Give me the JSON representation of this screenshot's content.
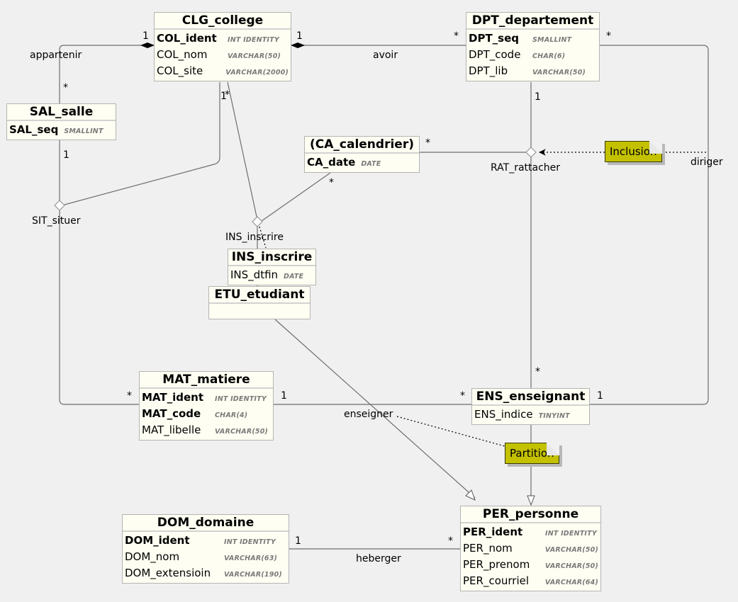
{
  "entities": {
    "clg": {
      "title": "CLG_college",
      "fields": [
        {
          "name": "COL_ident",
          "type": "INT IDENTITY",
          "pk": true
        },
        {
          "name": "COL_nom",
          "type": "VARCHAR(50)",
          "pk": false
        },
        {
          "name": "COL_site",
          "type": "VARCHAR(2000)",
          "pk": false
        }
      ]
    },
    "dpt": {
      "title": "DPT_departement",
      "fields": [
        {
          "name": "DPT_seq",
          "type": "SMALLINT",
          "pk": true
        },
        {
          "name": "DPT_code",
          "type": "CHAR(6)",
          "pk": false
        },
        {
          "name": "DPT_lib",
          "type": "VARCHAR(50)",
          "pk": false
        }
      ]
    },
    "sal": {
      "title": "SAL_salle",
      "fields": [
        {
          "name": "SAL_seq",
          "type": "SMALLINT",
          "pk": true
        }
      ]
    },
    "ca": {
      "title": "(CA_calendrier)",
      "fields": [
        {
          "name": "CA_date",
          "type": "DATE",
          "pk": true
        }
      ]
    },
    "ins": {
      "title": "INS_inscrire",
      "fields": [
        {
          "name": "INS_dtfin",
          "type": "DATE",
          "pk": false
        }
      ]
    },
    "etu": {
      "title": "ETU_etudiant",
      "fields": []
    },
    "mat": {
      "title": "MAT_matiere",
      "fields": [
        {
          "name": "MAT_ident",
          "type": "INT IDENTITY",
          "pk": true
        },
        {
          "name": "MAT_code",
          "type": "CHAR(4)",
          "pk": true
        },
        {
          "name": "MAT_libelle",
          "type": "VARCHAR(50)",
          "pk": false
        }
      ]
    },
    "ens": {
      "title": "ENS_enseignant",
      "fields": [
        {
          "name": "ENS_indice",
          "type": "TINYINT",
          "pk": false
        }
      ]
    },
    "dom": {
      "title": "DOM_domaine",
      "fields": [
        {
          "name": "DOM_ident",
          "type": "INT IDENTITY",
          "pk": true
        },
        {
          "name": "DOM_nom",
          "type": "VARCHAR(63)",
          "pk": false
        },
        {
          "name": "DOM_extensioin",
          "type": "VARCHAR(190)",
          "pk": false
        }
      ]
    },
    "per": {
      "title": "PER_personne",
      "fields": [
        {
          "name": "PER_ident",
          "type": "INT IDENTITY",
          "pk": true
        },
        {
          "name": "PER_nom",
          "type": "VARCHAR(50)",
          "pk": false
        },
        {
          "name": "PER_prenom",
          "type": "VARCHAR(50)",
          "pk": false
        },
        {
          "name": "PER_courriel",
          "type": "VARCHAR(64)",
          "pk": false
        }
      ]
    }
  },
  "associations": {
    "appartenir": "appartenir",
    "avoir": "avoir",
    "rattacher": "RAT_rattacher",
    "diriger": "diriger",
    "situer": "SIT_situer",
    "inscrire": "INS_inscrire",
    "enseigner": "enseigner",
    "heberger": "heberger"
  },
  "multiplicities": {
    "appartenir_clg": "1",
    "appartenir_sal": "*",
    "avoir_clg": "1",
    "avoir_dpt": "*",
    "diriger_dpt": "*",
    "diriger_ens": "1",
    "rattacher_dpt": "1",
    "rattacher_ca": "*",
    "rattacher_ens": "*",
    "situer_sal": "1",
    "situer_clg": "1",
    "inscrire_clg": "*",
    "inscrire_ca": "*",
    "enseigner_mat_left": "*",
    "enseigner_mat_right": "1",
    "enseigner_ens": "*",
    "heberger_dom": "1",
    "heberger_per": "*"
  },
  "notes": {
    "inclusion": "Inclusion",
    "partition": "Partition"
  },
  "colors": {
    "background": "#f0f0f0",
    "entity_fill": "#fefef2",
    "note_fill": "#c3c100",
    "line": "#6e6e6e"
  }
}
